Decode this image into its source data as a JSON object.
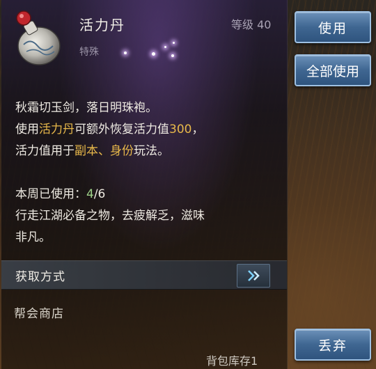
{
  "item": {
    "name": "活力丹",
    "type": "特殊",
    "level_label": "等级",
    "level": "40",
    "icon": "potion-bottle-icon"
  },
  "description": {
    "line1": "秋霜切玉剑，落日明珠袍。",
    "line2_pre": "使用",
    "line2_item": "活力丹",
    "line2_mid": "可额外恢复活力值",
    "line2_value": "300",
    "line2_end": "，",
    "line3_pre": "活力值用于",
    "line3_hl": "副本、身份",
    "line3_end": "玩法。",
    "weekly_label": "本周已使用：",
    "weekly_used": "4",
    "weekly_total": "/6",
    "flavor1": "行走江湖必备之物，去疲解乏，滋味",
    "flavor2": "非凡。"
  },
  "acquire": {
    "label": "获取方式",
    "arrow_icon": "arrow-right-icon",
    "source": "帮会商店"
  },
  "buttons": {
    "use": "使用",
    "use_all": "全部使用",
    "drop": "丢弃"
  },
  "footer": {
    "inventory": "背包库存1"
  },
  "colors": {
    "highlight": "#e8b84a",
    "used_count": "#9fd28a",
    "button": "#3f6691"
  }
}
